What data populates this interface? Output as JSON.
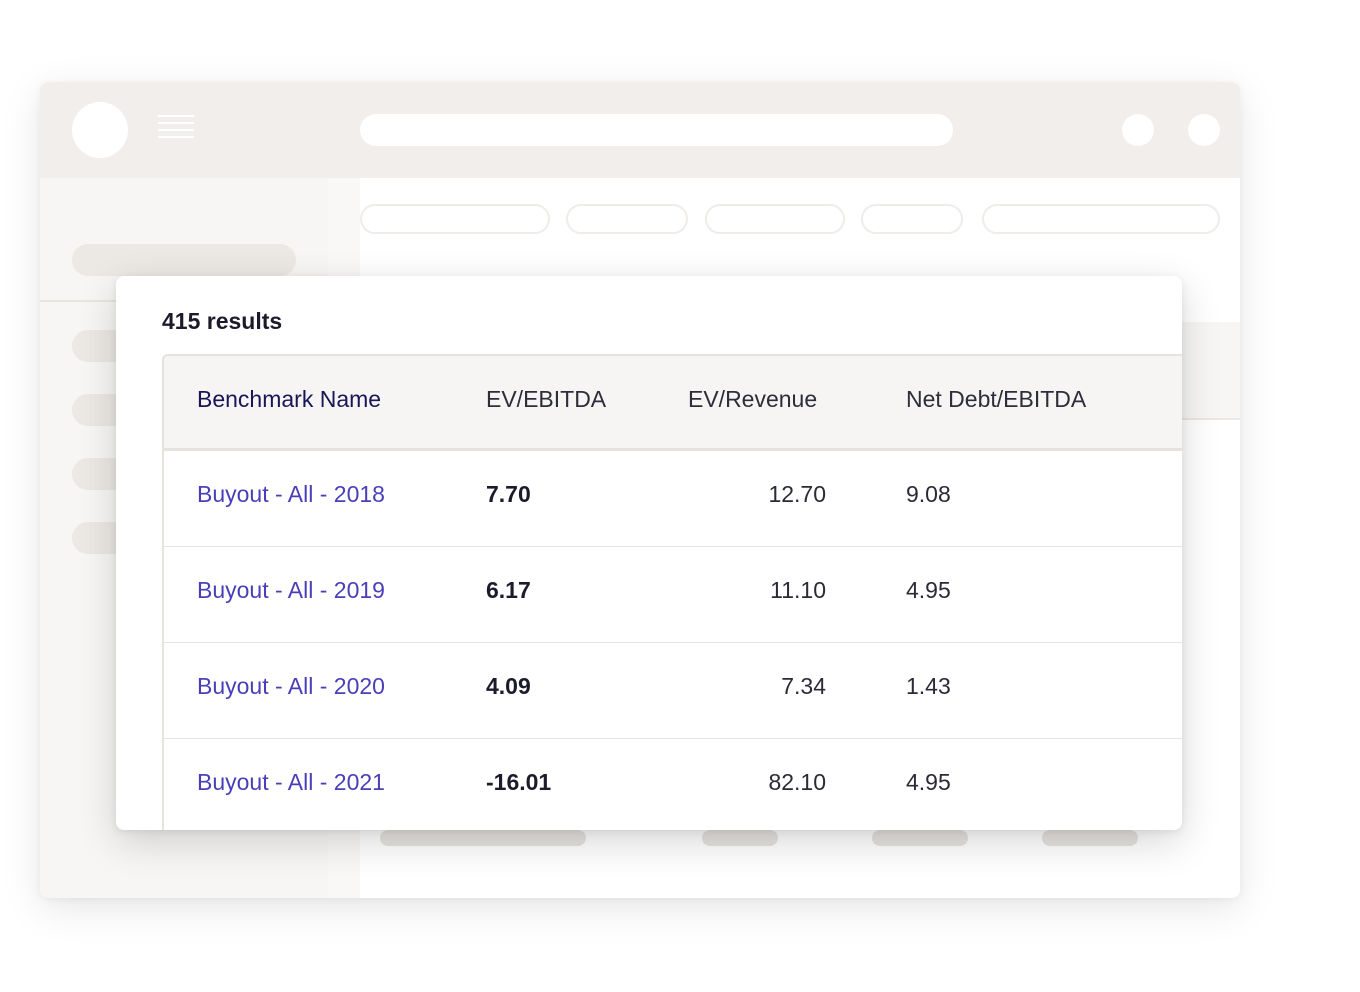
{
  "results": {
    "count_label": "415 results"
  },
  "table": {
    "columns": [
      "Benchmark Name",
      "EV/EBITDA",
      "EV/Revenue",
      "Net Debt/EBITDA"
    ],
    "rows": [
      {
        "name": "Buyout - All - 2018",
        "ev_ebitda": "7.70",
        "ev_revenue": "12.70",
        "net_debt_ebitda": "9.08"
      },
      {
        "name": "Buyout - All - 2019",
        "ev_ebitda": "6.17",
        "ev_revenue": "11.10",
        "net_debt_ebitda": "4.95"
      },
      {
        "name": "Buyout - All - 2020",
        "ev_ebitda": "4.09",
        "ev_revenue": "7.34",
        "net_debt_ebitda": "1.43"
      },
      {
        "name": "Buyout - All - 2021",
        "ev_ebitda": "-16.01",
        "ev_revenue": "82.10",
        "net_debt_ebitda": "4.95"
      }
    ]
  },
  "colors": {
    "link": "#4a3fb8",
    "header_text": "#1a1556",
    "header_bg": "#f6f5f3",
    "background_chrome": "#f1eeeb"
  }
}
